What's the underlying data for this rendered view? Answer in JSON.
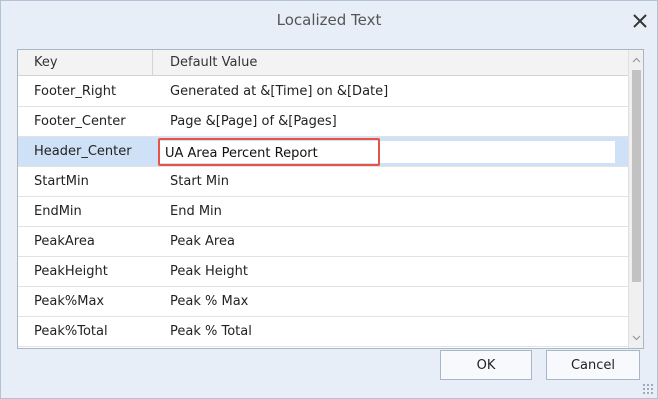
{
  "window": {
    "title": "Localized Text"
  },
  "table": {
    "columns": [
      "Key",
      "Default Value"
    ],
    "rows": [
      {
        "key": "Footer_Right",
        "value": "Generated at &[Time] on &[Date]"
      },
      {
        "key": "Footer_Center",
        "value": "Page &[Page] of &[Pages]"
      },
      {
        "key": "Header_Center",
        "value": "UA Area Percent Report",
        "selected": true,
        "editing": true
      },
      {
        "key": "StartMin",
        "value": "Start Min"
      },
      {
        "key": "EndMin",
        "value": "End Min"
      },
      {
        "key": "PeakArea",
        "value": "Peak Area"
      },
      {
        "key": "PeakHeight",
        "value": "Peak Height"
      },
      {
        "key": "Peak%Max",
        "value": "Peak % Max"
      },
      {
        "key": "Peak%Total",
        "value": "Peak % Total"
      }
    ]
  },
  "buttons": {
    "ok": "OK",
    "cancel": "Cancel"
  },
  "icons": {
    "close": "close-icon",
    "scroll_up": "chevron-up-icon",
    "scroll_down": "chevron-down-icon",
    "resize": "resize-grip-icon"
  },
  "colors": {
    "selected_row": "#cfe1f6",
    "edit_highlight": "#e5544b",
    "dialog_bg": "#e7eef8"
  }
}
